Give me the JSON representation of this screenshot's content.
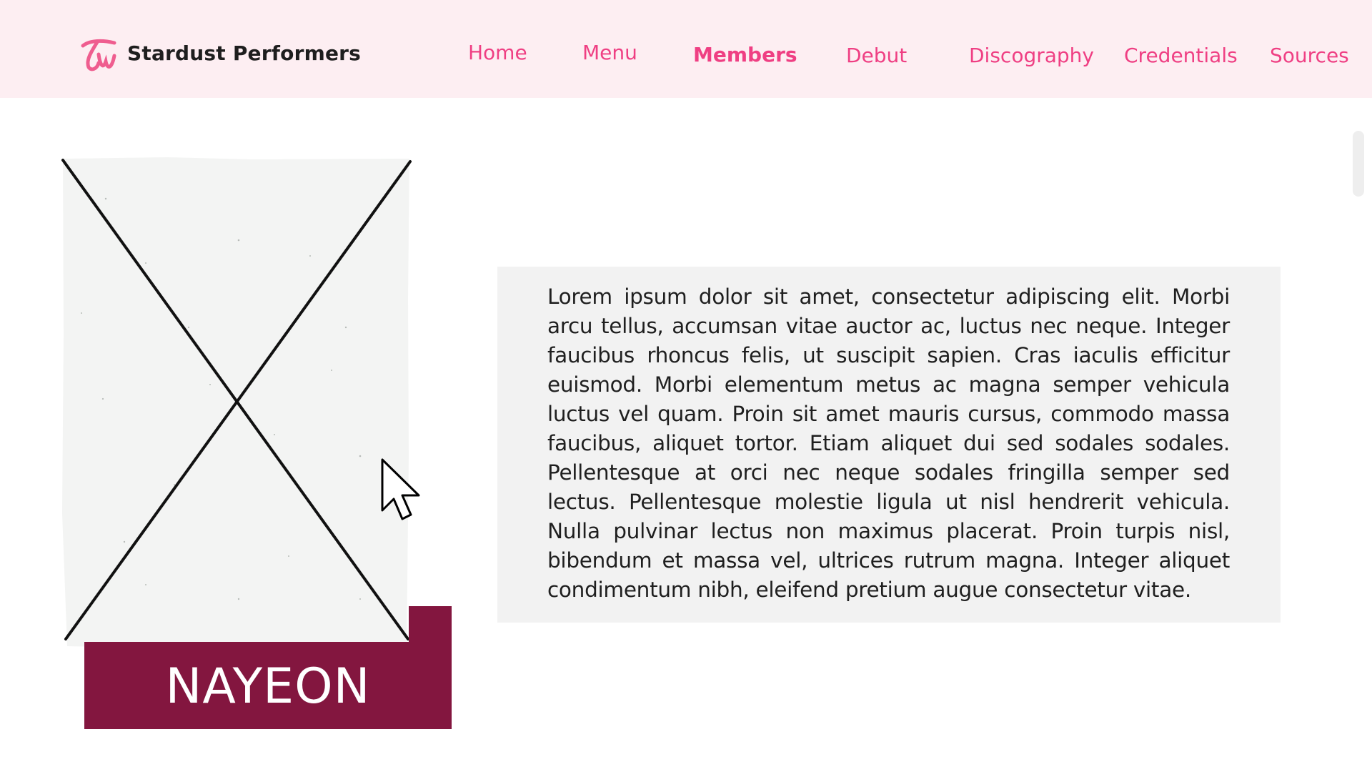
{
  "brand": {
    "name": "Stardust Performers",
    "logo_icon": "tw-script-logo-icon",
    "accent_color": "#ef3f83"
  },
  "nav": {
    "items": [
      {
        "label": "Home"
      },
      {
        "label": "Menu"
      },
      {
        "label": "Members",
        "active": true
      },
      {
        "label": "Debut"
      },
      {
        "label": "Discography"
      },
      {
        "label": "Credentials"
      },
      {
        "label": "Sources"
      }
    ]
  },
  "member": {
    "name": "NAYEON",
    "plate_color": "#83163f",
    "photo_icon": "image-placeholder-icon",
    "bio": "Lorem ipsum dolor sit amet, consectetur adipiscing elit. Morbi arcu tellus, accumsan vitae auctor ac, luctus nec neque. Integer faucibus rhoncus felis, ut suscipit sapien. Cras iaculis efficitur euismod. Morbi elementum metus ac magna semper vehicula luctus vel quam. Proin sit amet mauris cursus, commodo massa faucibus, aliquet tortor. Etiam aliquet dui sed sodales sodales. Pellentesque at orci nec neque sodales fringilla semper sed lectus. Pellentesque molestie ligula ut nisl hendrerit vehicula. Nulla pulvinar lectus non maximus placerat. Proin turpis nisl, bibendum et massa vel, ultrices rutrum magna. Integer aliquet condimentum nibh, eleifend pretium augue consectetur vitae."
  },
  "cursor_icon": "mouse-pointer-icon"
}
